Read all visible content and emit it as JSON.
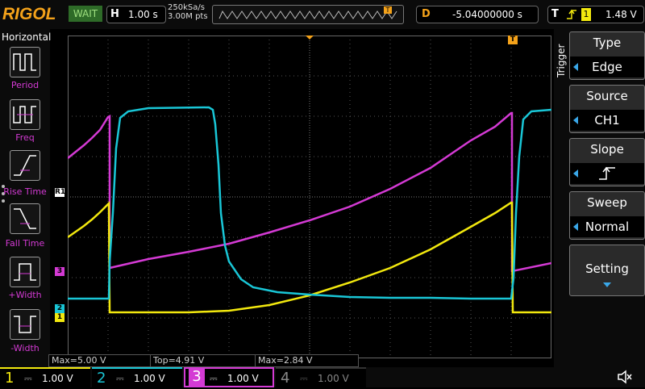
{
  "brand": "RIGOL",
  "status": "WAIT",
  "timebase": {
    "label": "H",
    "value": "1.00 s"
  },
  "acquisition": {
    "sample_rate": "250kSa/s",
    "memory_depth": "3.00M pts"
  },
  "delay": {
    "label": "D",
    "value": "-5.04000000 s"
  },
  "trigger_summary": {
    "label": "T",
    "source": "1",
    "level": "1.48 V"
  },
  "left_menu": {
    "title": "Horizontal",
    "items": [
      {
        "label": "Period",
        "icon": "period-icon"
      },
      {
        "label": "Freq",
        "icon": "freq-icon"
      },
      {
        "label": "Rise Time",
        "icon": "rise-time-icon"
      },
      {
        "label": "Fall Time",
        "icon": "fall-time-icon"
      },
      {
        "label": "+Width",
        "icon": "positive-width-icon"
      },
      {
        "label": "-Width",
        "icon": "negative-width-icon"
      }
    ]
  },
  "right_menu": {
    "title": "Trigger",
    "items": [
      {
        "label": "Type",
        "value": "Edge"
      },
      {
        "label": "Source",
        "value": "CH1"
      },
      {
        "label": "Slope",
        "value": "rising-edge-icon"
      },
      {
        "label": "Sweep",
        "value": "Normal"
      },
      {
        "label": "Setting"
      }
    ]
  },
  "measurements": [
    "Max=5.00 V",
    "Top=4.91 V",
    "Max=2.84 V"
  ],
  "markers": {
    "r1": "R1",
    "ch1": "1",
    "ch2": "2",
    "ch3": "3",
    "trig_pos": "T",
    "trig_level": "T"
  },
  "channels": [
    {
      "num": "1",
      "coupling": "⎓",
      "scale": "1.00 V",
      "color": "#f2e80e",
      "active": false
    },
    {
      "num": "2",
      "coupling": "⎓",
      "scale": "1.00 V",
      "color": "#19c6d6",
      "active": false
    },
    {
      "num": "3",
      "coupling": "⎓",
      "scale": "1.00 V",
      "color": "#d43ad4",
      "active": true
    },
    {
      "num": "4",
      "coupling": "⎓",
      "scale": "1.00 V",
      "color": "#4a7bdc",
      "active": false
    }
  ],
  "colors": {
    "ch1": "#f2e80e",
    "ch2": "#19c6d6",
    "ch3": "#d43ad4",
    "accent": "#f4a21a",
    "status_bg": "#2e6b28"
  }
}
